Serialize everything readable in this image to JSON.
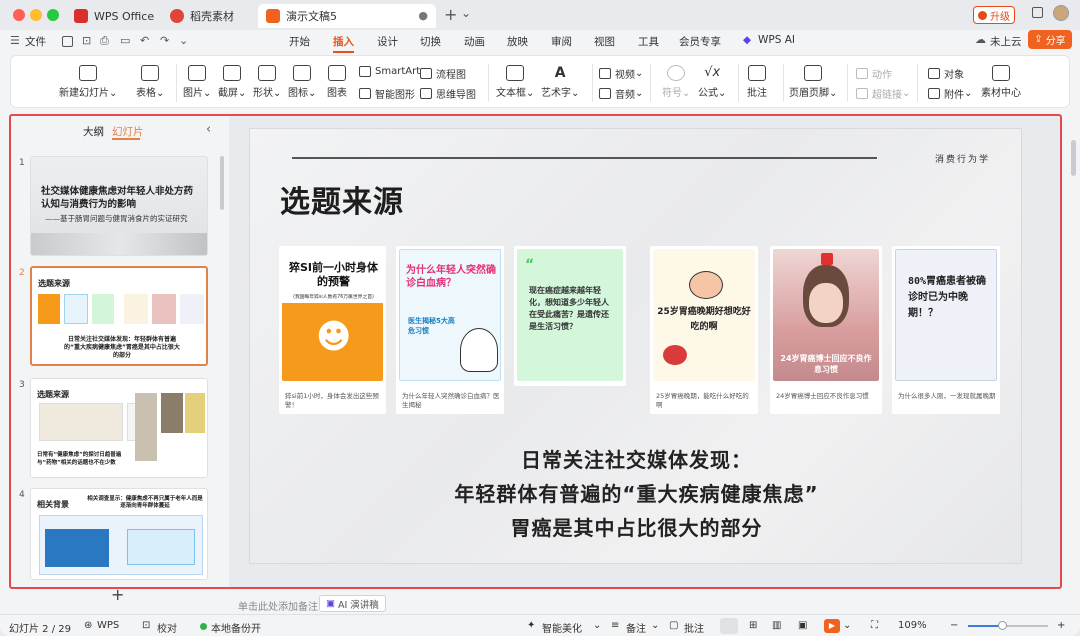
{
  "titlebar": {
    "tabs": [
      {
        "label": "WPS Office",
        "color": "#d9302c"
      },
      {
        "label": "稻壳素材",
        "color": "#e0453a"
      },
      {
        "label": "演示文稿5",
        "color": "#f0621f"
      }
    ],
    "new_tab": "+",
    "tab_menu": "⌄",
    "upgrade": "升级"
  },
  "menubar": {
    "file": "文件",
    "items": [
      "开始",
      "插入",
      "设计",
      "切换",
      "动画",
      "放映",
      "审阅",
      "视图",
      "工具",
      "会员专享",
      "WPS AI"
    ],
    "active": "插入",
    "cloud": "未上云",
    "share": "分享"
  },
  "ribbon": {
    "new_slide": "新建幻灯片",
    "table": "表格",
    "picture": "图片",
    "screenshot": "截屏",
    "shape": "形状",
    "icon": "图标",
    "chart": "图表",
    "smartart": "SmartArt",
    "smart_graphic": "智能图形",
    "flowchart": "流程图",
    "mindmap": "思维导图",
    "textbox": "文本框",
    "wordart": "艺术字",
    "video": "视频",
    "audio": "音频",
    "symbol": "符号",
    "formula": "公式",
    "comment": "批注",
    "header_footer": "页眉页脚",
    "animation": "动作",
    "hyperlink": "超链接",
    "object": "对象",
    "attachment": "附件",
    "material": "素材中心"
  },
  "panel": {
    "tab_outline": "大纲",
    "tab_slides": "幻灯片",
    "add": "+",
    "thumbs": [
      {
        "num": "1",
        "title": "社交媒体健康焦虑对年轻人非处方药认知与消费行为的影响",
        "sub": "——基于肠胃问题与健胃消食片的实证研究"
      },
      {
        "num": "2",
        "title": "选题来源",
        "sub": "日常关注社交媒体发现：年轻群体有普遍的“重大疾病健康焦虑”胃癌是其中占比很大的部分"
      },
      {
        "num": "3",
        "title": "选题来源",
        "sub": "日常有“健康焦虑”的探讨日趋普遍与“药物”相关的话题也不在少数"
      },
      {
        "num": "4",
        "title": "相关背景",
        "sub": "相关调查显示：健康焦虑不再只属于老年人而是逐渐向青年群体蔓延"
      }
    ]
  },
  "slide": {
    "tag": "消费行为学",
    "title": "选题来源",
    "cards": [
      {
        "head": "猝SI前一小时身体的预警",
        "sub": "(我国每年猝si人数有76万属世界之首)",
        "caption": "猝si前1小时，身体会发出这些预警！"
      },
      {
        "head": "为什么年轻人突然确诊白血病？",
        "sub": "医生揭秘5大高危习惯",
        "caption": "为什么年轻人突然确诊白血病？医生揭秘"
      },
      {
        "head": "现在癌症越来越年轻化，想知道多少年轻人在受此痛苦？是遗传还是生活习惯？",
        "caption": ""
      },
      {
        "head": "25岁胃癌晚期好想吃好吃的啊",
        "caption": "25岁胃癌晚期，能吃什么好吃的啊"
      },
      {
        "head": "24岁胃癌博士回应不良作息习惯",
        "caption": "24岁胃癌博士回应不良作息习惯"
      },
      {
        "head": "80%胃癌患者被确诊时已为中晚期！？",
        "caption": "为什么很多人刚，一发现就属晚期"
      }
    ],
    "line1": "日常关注社交媒体发现：",
    "line2": "年轻群体有普遍的“重大疾病健康焦虑”",
    "line3": "胃癌是其中占比很大的部分"
  },
  "notes": {
    "placeholder": "单击此处添加备注",
    "ai": "AI 演讲稿"
  },
  "status": {
    "slide_pos": "幻灯片 2 / 29",
    "wps": "WPS",
    "proof": "校对",
    "backup": "本地备份开",
    "beautify": "智能美化",
    "notes": "备注",
    "comments": "批注",
    "zoom": "109%",
    "zoom_fraction": 0.42
  }
}
